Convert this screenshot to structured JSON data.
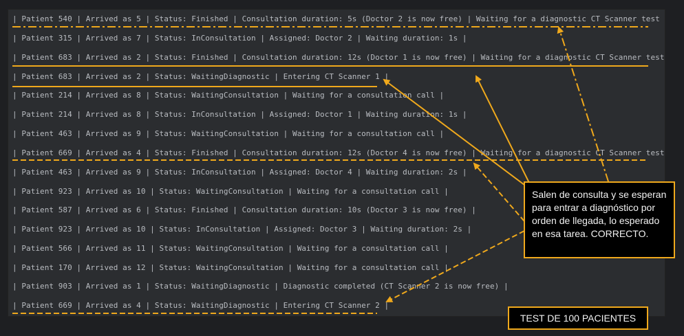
{
  "terminal": {
    "lines": [
      "| Patient 540 | Arrived as 5 | Status: Finished | Consultation duration: 5s (Doctor 2 is now free) | Waiting for a diagnostic CT Scanner test |",
      "| Patient 315 | Arrived as 7 | Status: InConsultation | Assigned: Doctor 2 | Waiting duration: 1s |",
      "| Patient 683 | Arrived as 2 | Status: Finished | Consultation duration: 12s (Doctor 1 is now free) | Waiting for a diagnostic CT Scanner test |",
      "| Patient 683 | Arrived as 2 | Status: WaitingDiagnostic | Entering CT Scanner 1 |",
      "| Patient 214 | Arrived as 8 | Status: WaitingConsultation | Waiting for a consultation call |",
      "| Patient 214 | Arrived as 8 | Status: InConsultation | Assigned: Doctor 1 | Waiting duration: 1s |",
      "| Patient 463 | Arrived as 9 | Status: WaitingConsultation | Waiting for a consultation call |",
      "| Patient 669 | Arrived as 4 | Status: Finished | Consultation duration: 12s (Doctor 4 is now free) | Waiting for a diagnostic CT Scanner test |",
      "| Patient 463 | Arrived as 9 | Status: InConsultation | Assigned: Doctor 4 | Waiting duration: 2s |",
      "| Patient 923 | Arrived as 10 | Status: WaitingConsultation | Waiting for a consultation call |",
      "| Patient 587 | Arrived as 6 | Status: Finished | Consultation duration: 10s (Doctor 3 is now free) |",
      "| Patient 923 | Arrived as 10 | Status: InConsultation | Assigned: Doctor 3 | Waiting duration: 2s |",
      "| Patient 566 | Arrived as 11 | Status: WaitingConsultation | Waiting for a consultation call |",
      "| Patient 170 | Arrived as 12 | Status: WaitingConsultation | Waiting for a consultation call |",
      "| Patient 903 | Arrived as 1 | Status: WaitingDiagnostic | Diagnostic completed (CT Scanner 2 is now free) |",
      "| Patient 669 | Arrived as 4 | Status: WaitingDiagnostic | Entering CT Scanner 2 |"
    ]
  },
  "annotations": {
    "callout_text": "Salen de consulta y se esperan para entrar a diagnóstico por orden de llegada, lo esperado en esa tarea. CORRECTO.",
    "test_label": "TEST DE 100 PACIENTES",
    "color": "#f0a91c"
  }
}
